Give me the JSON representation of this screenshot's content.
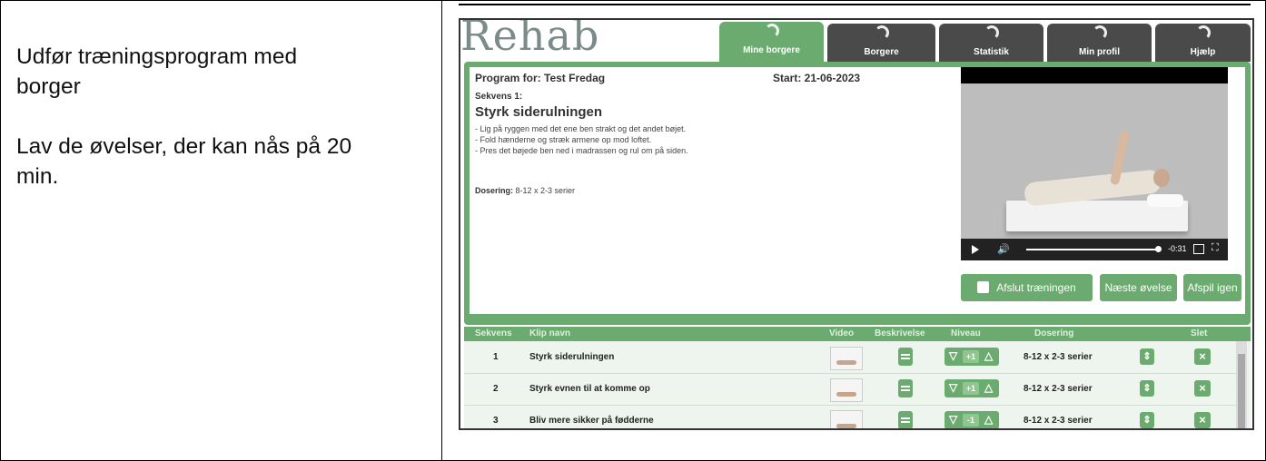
{
  "left": {
    "line1": "Udfør træningsprogram med",
    "line2": "borger",
    "line3": "Lav de øvelser, der kan nås på 20",
    "line4": "min."
  },
  "app": {
    "logo": "Rehab",
    "tabs": [
      {
        "label": "Mine borgere",
        "active": true
      },
      {
        "label": "Borgere"
      },
      {
        "label": "Statistik"
      },
      {
        "label": "Min profil"
      },
      {
        "label": "Hjælp"
      }
    ]
  },
  "program": {
    "program_label": "Program for: Test Fredag",
    "start_label": "Start: 21-06-2023",
    "sequence_label": "Sekvens 1:",
    "exercise_title": "Styrk siderulningen",
    "desc": [
      "- Lig på ryggen med det ene ben strakt og det andet bøjet.",
      "- Fold hænderne og stræk armene op mod loftet.",
      "- Pres det bøjede ben ned i madrassen og rul om på siden."
    ],
    "dose_key": "Dosering:",
    "dose_value": "8-12 x 2-3 serier"
  },
  "video": {
    "time": "-0:31",
    "progress": 0.98
  },
  "buttons": {
    "finish": "Afslut træningen",
    "next": "Næste øvelse",
    "replay": "Afspil igen"
  },
  "table": {
    "headers": [
      "Sekvens",
      "Klip navn",
      "Video",
      "Beskrivelse",
      "Niveau",
      "Dosering",
      "Slet"
    ],
    "rows": [
      {
        "seq": "1",
        "name": "Styrk siderulningen",
        "level": "+1",
        "dose": "8-12 x 2-3 serier"
      },
      {
        "seq": "2",
        "name": "Styrk evnen til at komme op",
        "level": "+1",
        "dose": "8-12 x 2-3 serier"
      },
      {
        "seq": "3",
        "name": "Bliv mere sikker på fødderne",
        "level": "-1",
        "dose": "8-12 x 2-3 serier"
      }
    ]
  },
  "colors": {
    "accent": "#6cab6f",
    "dark_tab": "#4a4a4a"
  },
  "icons": [
    "play-icon",
    "volume-icon",
    "pip-icon",
    "fullscreen-icon",
    "document-icon",
    "arrow-down-icon",
    "arrow-up-icon",
    "move-icon",
    "delete-icon"
  ]
}
